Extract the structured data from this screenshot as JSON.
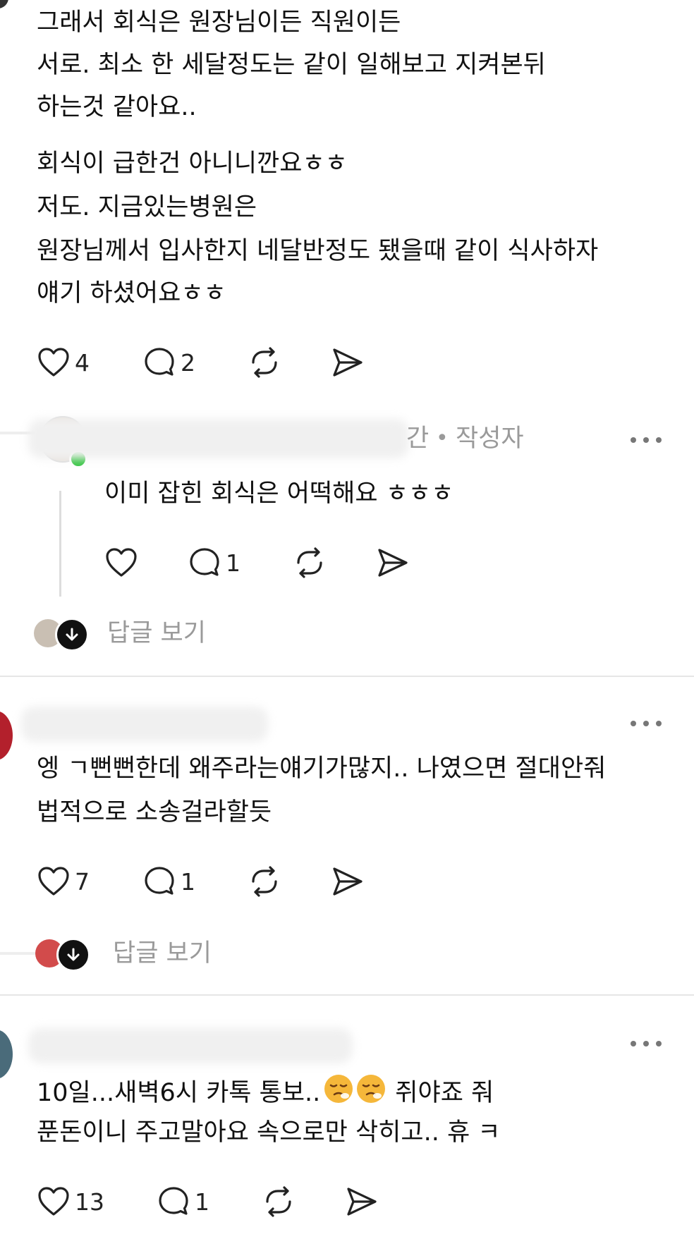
{
  "comment1": {
    "paragraph1": [
      "그래서 회식은 원장님이든 직원이든",
      "서로. 최소 한  세달정도는 같이 일해보고 지켜본뒤",
      "하는것 같아요.."
    ],
    "paragraph2": [
      "회식이 급한건 아니니깐요ㅎㅎ",
      "저도. 지금있는병원은",
      " 원장님께서 입사한지 네달반정도 됐을때 같이 식사하자",
      "얘기 하셨어요ㅎㅎ"
    ],
    "likes": "4",
    "replies": "2"
  },
  "reply1": {
    "time_fragment": "간",
    "separator": "•",
    "author_badge": "작성자",
    "text": "이미 잡힌 회식은 어떡해요 ㅎㅎㅎ",
    "replies": "1",
    "view_replies": "답글 보기"
  },
  "comment2": {
    "text": [
      "엥 ㄱ뻔뻔한데 왜주라는얘기가많지.. 나였으면 절대안줘",
      "법적으로 소송걸라할듯"
    ],
    "likes": "7",
    "replies": "1",
    "view_replies": "답글 보기"
  },
  "comment3": {
    "text": [
      "10일...새벽6시 카톡 통보..",
      "쥐야죠 줘",
      "푼돈이니 주고말아요 속으로만 삭히고.. 휴 ㅋ"
    ],
    "likes": "13",
    "replies": "1"
  },
  "icons": {
    "like": "heart-icon",
    "comment": "comment-bubble-icon",
    "repost": "repost-icon",
    "share": "send-icon",
    "more": "more-dots-icon",
    "emoji": "exhaling-face-emoji"
  },
  "colors": {
    "text": "#111111",
    "muted": "#9a9a9a",
    "divider": "#e6e6e6",
    "thread_line": "#dddddd",
    "online": "#3ec74a"
  }
}
